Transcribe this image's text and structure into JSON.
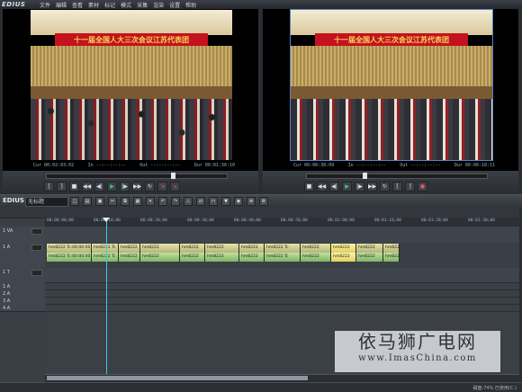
{
  "app": {
    "logo": "EDIUS"
  },
  "menu": [
    "文件",
    "编辑",
    "查看",
    "素材",
    "标记",
    "模式",
    "采集",
    "渲染",
    "设置",
    "帮助"
  ],
  "player": {
    "banner": "十一届全国人大三次会议江苏代表团",
    "tc_cur": "Cur 00:02:03:02",
    "tc_in": "In --:--:--:--",
    "tc_out": "Out --:--:--:--",
    "tc_dur": "Dur 00:01:36:10"
  },
  "recorder": {
    "banner": "十一届全国人大三次会议江苏代表团",
    "tc_cur": "Cur 00:00:38:09",
    "tc_in": "In --:--:--:--",
    "tc_out": "Out --:--:--:--",
    "tc_dur": "Dur 00:00:18:11"
  },
  "timeline": {
    "logo": "EDIUS",
    "sequence_name": "无标题",
    "ruler": [
      "00:00:00;00",
      "00:00:10;00",
      "00:00:20;00",
      "00:00:30;00",
      "00:00:40;00",
      "00:00:50;00",
      "00:01:00;00",
      "00:01:10;00",
      "00:01:20;00",
      "00:01:30;00"
    ],
    "tracks": [
      {
        "label": "1 VA",
        "toggle": "V"
      },
      {
        "label": "1 A",
        "toggle": ""
      },
      {
        "label": "1 T",
        "toggle": ""
      },
      {
        "label": "1 A",
        "toggle": ""
      },
      {
        "label": "2 A",
        "toggle": ""
      },
      {
        "label": "3 A",
        "toggle": ""
      },
      {
        "label": "4 A",
        "toggle": ""
      }
    ],
    "clip_label": "hm8222",
    "video_clips": [
      "hm8222 Tc:00:00:00",
      "hm8222 Tc",
      "hm8222",
      "hm8222",
      "hm8222",
      "hm8222",
      "hm8222",
      "hm8222 Tc",
      "hm8222",
      "hm8222",
      "hm8222",
      "hm8222"
    ],
    "audio_clips": [
      "hm8222 Tc:00:00:00",
      "hm8222 Tc",
      "hm8222",
      "hm8222",
      "hm8222",
      "hm8222",
      "hm8222",
      "hm8222 Tc",
      "hm8222",
      "hm8222",
      "hm8222",
      "hm8222"
    ]
  },
  "status": {
    "text": "磁盘:74% 已使用(C:)"
  },
  "watermark": {
    "line1": "依马狮广电网",
    "line2": "www.ImasChina.com"
  }
}
